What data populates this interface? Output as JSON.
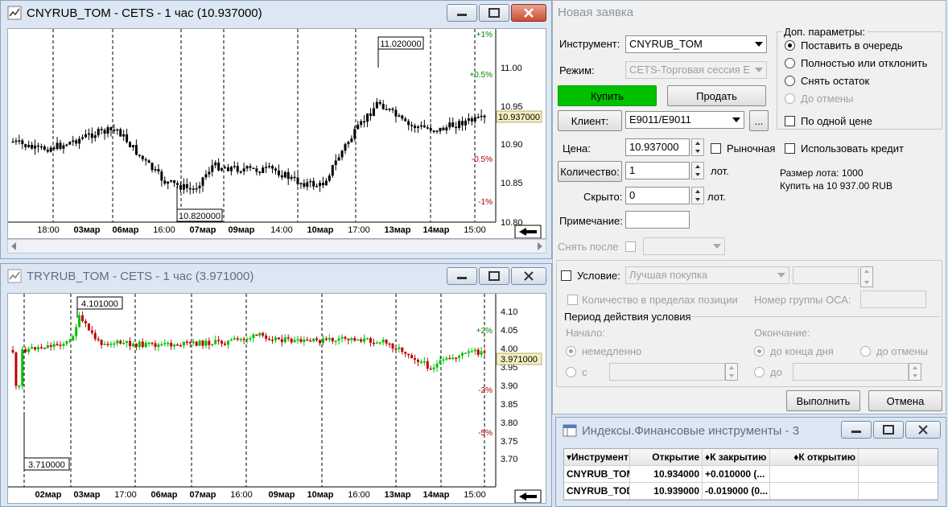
{
  "chart1": {
    "title": "CNYRUB_TOM - CETS - 1 час (10.937000)",
    "hi_label": "11.020000",
    "lo_label": "10.820000",
    "last_label": "10.937000",
    "price_ticks": [
      "11.00",
      "10.95",
      "10.90",
      "10.85",
      "10.80"
    ],
    "pct_ticks": [
      "+1%",
      "+0.5%",
      "-0.5%",
      "-1%"
    ],
    "time_ticks": [
      "18:00",
      "03мар",
      "06мар",
      "16:00",
      "07мар",
      "09мар",
      "14:00",
      "10мар",
      "17:00",
      "13мар",
      "14мар",
      "15:00"
    ]
  },
  "chart2": {
    "title": "TRYRUB_TOM - CETS - 1 час (3.971000)",
    "hi_label": "4.101000",
    "lo_label": "3.710000",
    "last_label": "3.971000",
    "price_ticks": [
      "4.10",
      "4.05",
      "4.00",
      "3.95",
      "3.90",
      "3.85",
      "3.80",
      "3.75",
      "3.70"
    ],
    "pct_ticks": [
      "+2%",
      "-2%",
      "-5%"
    ],
    "time_ticks": [
      "02мар",
      "03мар",
      "17:00",
      "06мар",
      "07мар",
      "16:00",
      "09мар",
      "10мар",
      "16:00",
      "13мар",
      "14мар",
      "15:00"
    ]
  },
  "order": {
    "title": "Новая заявка",
    "instrument_label": "Инструмент:",
    "instrument_value": "CNYRUB_TOM",
    "mode_label": "Режим:",
    "mode_value": "CETS-Торговая сессия Е",
    "buy_label": "Купить",
    "sell_label": "Продать",
    "client_label": "Клиент:",
    "client_value": "E9011/E9011",
    "client_more": "...",
    "price_label": "Цена:",
    "price_value": "10.937000",
    "market_label": "Рыночная",
    "qty_label": "Количество:",
    "qty_value": "1",
    "qty_unit": "лот.",
    "hidden_label": "Скрыто:",
    "hidden_value": "0",
    "hidden_unit": "лот.",
    "note_label": "Примечание:",
    "remove_after_label": "Снять после",
    "extra_title": "Доп. параметры:",
    "opt_queue": "Поставить в очередь",
    "opt_fill_or_kill": "Полностью или отклонить",
    "opt_remove_rest": "Снять остаток",
    "opt_until_cancel": "До отмены",
    "opt_single_price": "По одной цене",
    "use_credit_label": "Использовать кредит",
    "lot_size": "Размер лота: 1000",
    "buy_sum": "Купить на 10 937.00 RUB",
    "condition_label": "Условие:",
    "condition_value": "Лучшая покупка",
    "qty_in_position": "Количество в пределах позиции",
    "oca_group": "Номер группы ОСА:",
    "period_title": "Период действия условия",
    "start_label": "Начало:",
    "start_now": "немедленно",
    "start_from": "с",
    "end_label": "Окончание:",
    "end_day": "до конца дня",
    "end_cancel": "до отмены",
    "end_until": "до",
    "execute_label": "Выполнить",
    "cancel_label": "Отмена"
  },
  "index_window": {
    "title": "Индексы.Финансовые инструменты - 3",
    "columns": [
      "Инструмент",
      "Открытие",
      "К закрытию",
      "К открытию"
    ],
    "rows": [
      [
        "CNYRUB_TOM",
        "10.934000",
        "+0.010000 (...",
        ""
      ],
      [
        "CNYRUB_TOD",
        "10.939000",
        "-0.019000 (0...",
        ""
      ]
    ]
  },
  "colors": {
    "up_candle": "#00c000",
    "down_candle": "#c00000",
    "buy_button": "#00c000"
  }
}
